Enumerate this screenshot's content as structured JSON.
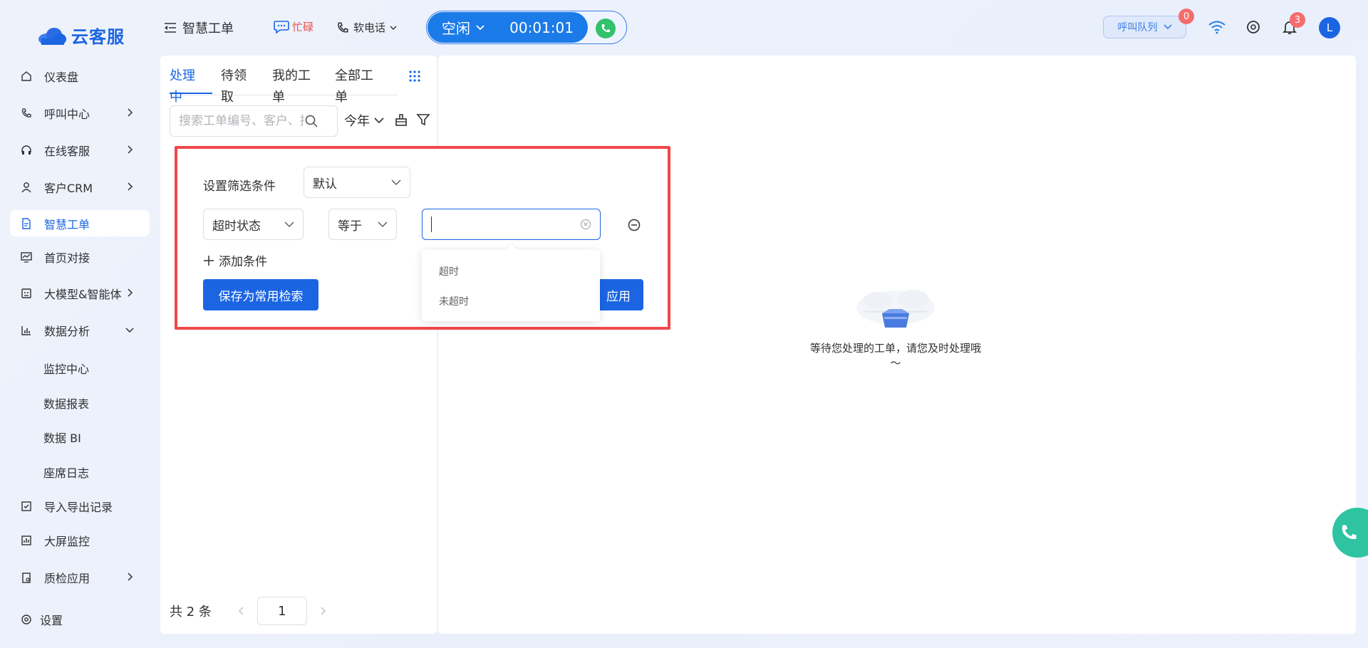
{
  "app": {
    "logo_text": "云客服"
  },
  "sidebar": {
    "items": [
      {
        "label": "仪表盘"
      },
      {
        "label": "呼叫中心"
      },
      {
        "label": "在线客服"
      },
      {
        "label": "客户CRM"
      },
      {
        "label": "智慧工单"
      },
      {
        "label": "首页对接"
      },
      {
        "label": "大模型&智能体"
      },
      {
        "label": "数据分析"
      },
      {
        "label": "监控中心"
      },
      {
        "label": "数据报表"
      },
      {
        "label": "数据 BI"
      },
      {
        "label": "座席日志"
      },
      {
        "label": "导入导出记录"
      },
      {
        "label": "大屏监控"
      },
      {
        "label": "质检应用"
      },
      {
        "label": "设置"
      }
    ]
  },
  "topbar": {
    "title": "智慧工单",
    "busy_label": "忙碌",
    "softphone_label": "软电话",
    "status_label": "空闲",
    "timer": "00:01:01",
    "queue_label": "呼叫队列",
    "queue_count": "0",
    "notification_count": "3",
    "avatar_initial": "L"
  },
  "list": {
    "tabs": [
      "处理中",
      "待领取",
      "我的工单",
      "全部工单"
    ],
    "active_tab": "处理中",
    "search_placeholder": "搜索工单编号、客户、描述",
    "year_filter": "今年",
    "pager": {
      "total_text": "共 2 条",
      "page": "1"
    }
  },
  "filter": {
    "label": "设置筛选条件",
    "preset": "默认",
    "field": "超时状态",
    "operator": "等于",
    "value": "",
    "add_condition": "添加条件",
    "save_button": "保存为常用检索",
    "apply_button": "应用",
    "options": [
      "超时",
      "未超时"
    ]
  },
  "empty_state": {
    "text": "等待您处理的工单，请您及时处理哦～"
  },
  "colors": {
    "primary": "#1b65e3",
    "highlight_border": "#f0484a",
    "busy": "#e8514a",
    "call_green": "#32c26b"
  }
}
